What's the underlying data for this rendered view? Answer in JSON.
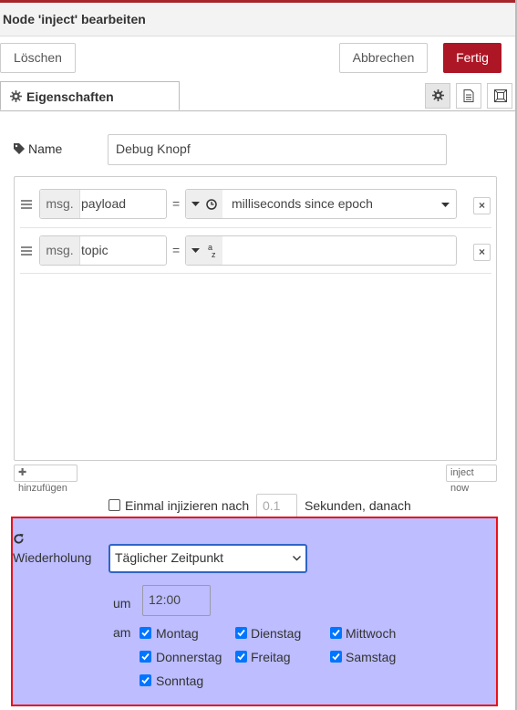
{
  "dialog": {
    "title": "Node 'inject' bearbeiten",
    "delete_label": "Löschen",
    "cancel_label": "Abbrechen",
    "done_label": "Fertig"
  },
  "tabs": {
    "properties_label": "Eigenschaften"
  },
  "name": {
    "label": "Name",
    "value": "Debug Knopf"
  },
  "props": [
    {
      "prefix": "msg.",
      "property": "payload",
      "eq": "=",
      "type_icon": "clock-icon",
      "value": "milliseconds since epoch"
    },
    {
      "prefix": "msg.",
      "property": "topic",
      "eq": "=",
      "type_icon": "string-az-icon",
      "value": ""
    }
  ],
  "list_buttons": {
    "add_label": "hinzufügen",
    "inject_now_label": "inject now"
  },
  "once": {
    "label": "Einmal injizieren nach",
    "delay_placeholder": "0.1",
    "suffix": "Sekunden, danach",
    "checked": false
  },
  "repeat": {
    "label": "Wiederholung",
    "mode": "Täglicher Zeitpunkt",
    "at_label": "um",
    "time": "12:00",
    "on_label": "am",
    "days": [
      {
        "name": "Montag",
        "checked": true
      },
      {
        "name": "Dienstag",
        "checked": true
      },
      {
        "name": "Mittwoch",
        "checked": true
      },
      {
        "name": "Donnerstag",
        "checked": true
      },
      {
        "name": "Freitag",
        "checked": true
      },
      {
        "name": "Samstag",
        "checked": true
      },
      {
        "name": "Sonntag",
        "checked": true
      }
    ]
  },
  "colors": {
    "accent": "#ad1625",
    "highlight_bg": "#bdbdff",
    "highlight_border": "#e8121c",
    "checkbox": "#0075ff"
  }
}
